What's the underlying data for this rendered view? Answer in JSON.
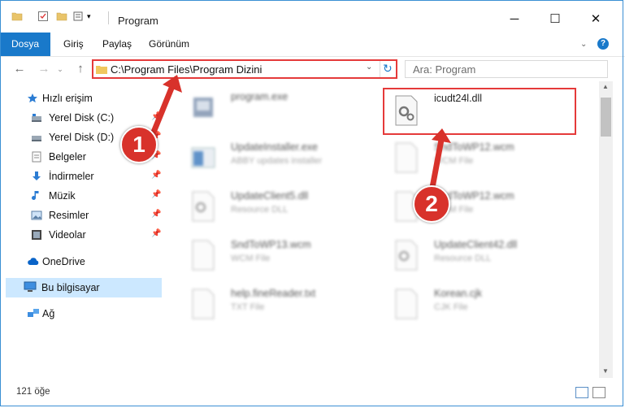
{
  "window": {
    "title": "Program"
  },
  "ribbon": {
    "tabs": [
      "Dosya",
      "Giriş",
      "Paylaş",
      "Görünüm"
    ]
  },
  "address": {
    "path": "C:\\Program Files\\Program Dizini",
    "search_placeholder": "Ara: Program"
  },
  "sidebar": {
    "quick_access": "Hızlı erişim",
    "items": [
      {
        "label": "Yerel Disk (C:)",
        "icon": "drive-icon",
        "pinned": true
      },
      {
        "label": "Yerel Disk (D:)",
        "icon": "drive-icon",
        "pinned": true
      },
      {
        "label": "Belgeler",
        "icon": "documents-icon",
        "pinned": true
      },
      {
        "label": "İndirmeler",
        "icon": "downloads-icon",
        "pinned": true
      },
      {
        "label": "Müzik",
        "icon": "music-icon",
        "pinned": true
      },
      {
        "label": "Resimler",
        "icon": "pictures-icon",
        "pinned": true
      },
      {
        "label": "Videolar",
        "icon": "videos-icon",
        "pinned": true
      }
    ],
    "onedrive": "OneDrive",
    "this_pc": "Bu bilgisayar",
    "network": "Ağ"
  },
  "files": [
    {
      "name": "program.exe",
      "type": "",
      "blurred": true
    },
    {
      "name": "icudt24l.dll",
      "type": "",
      "blurred": false,
      "highlighted": true
    },
    {
      "name": "UpdateInstaller.exe",
      "type": "ABBY updates installer",
      "blurred": true
    },
    {
      "name": "SndToWP12.wcm",
      "type": "WCM File",
      "blurred": true
    },
    {
      "name": "UpdateClient5.dll",
      "type": "Resource DLL",
      "blurred": true
    },
    {
      "name": "SndToWP12.wcm",
      "type": "WCM File",
      "blurred": true
    },
    {
      "name": "SndToWP13.wcm",
      "type": "WCM File",
      "blurred": true
    },
    {
      "name": "UpdateClient42.dll",
      "type": "Resource DLL",
      "blurred": true
    },
    {
      "name": "help.fineReader.txt",
      "type": "TXT File",
      "blurred": true
    },
    {
      "name": "Korean.cjk",
      "type": "CJK File",
      "blurred": true
    }
  ],
  "status": {
    "item_count": "121 öğe"
  },
  "annotations": {
    "step1": "1",
    "step2": "2"
  },
  "colors": {
    "accent": "#1979ca",
    "highlight": "#e53a3a",
    "selected": "#cce8ff"
  }
}
